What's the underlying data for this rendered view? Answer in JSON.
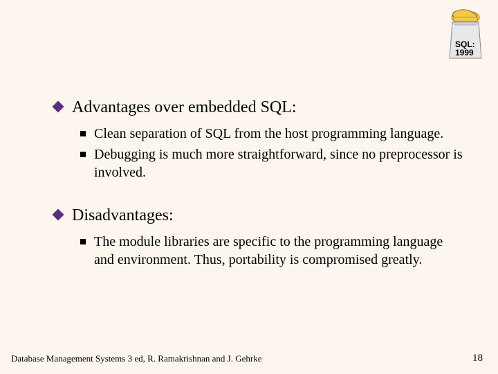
{
  "logo": {
    "caption_line1": "SQL:",
    "caption_line2": "1999"
  },
  "sections": {
    "advantages": {
      "heading": "Advantages over embedded SQL:",
      "items": {
        "0": "Clean separation of SQL from the host programming language.",
        "1": "Debugging is much more straightforward, since no preprocessor is involved."
      }
    },
    "disadvantages": {
      "heading": "Disadvantages:",
      "items": {
        "0": "The module libraries are specific to the programming language and environment. Thus, portability is compromised greatly."
      }
    }
  },
  "footer": {
    "left": "Database Management Systems 3 ed,  R. Ramakrishnan and J. Gehrke",
    "page": "18"
  }
}
